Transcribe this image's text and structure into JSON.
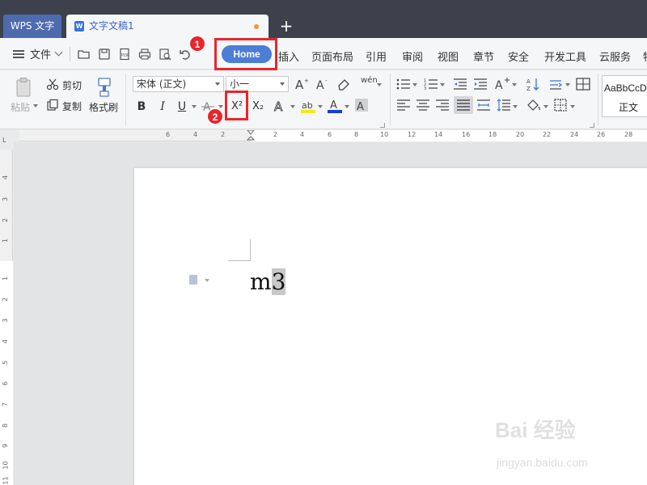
{
  "window": {
    "app_tab": "WPS 文字",
    "doc_tab": "文字文稿1",
    "doc_icon_letter": "W",
    "new_tab": "+"
  },
  "menu": {
    "file": "文件",
    "tabs": [
      "Home",
      "插入",
      "页面布局",
      "引用",
      "审阅",
      "视图",
      "章节",
      "安全",
      "开发工具",
      "云服务",
      "特"
    ]
  },
  "ribbon": {
    "paste": "粘贴",
    "cut": "剪切",
    "copy": "复制",
    "format_painter": "格式刷",
    "font_name": "宋体 (正文)",
    "font_size": "小一",
    "pinyin": "wén",
    "bold": "B",
    "italic": "I",
    "underline": "U",
    "superscript": "X²",
    "subscript": "X₂",
    "style_preview": "AaBbCcD",
    "style_name": "正文"
  },
  "ruler": {
    "top_numbers": [
      "6",
      "4",
      "2",
      "2",
      "4",
      "6",
      "8",
      "10",
      "12",
      "14",
      "16",
      "18",
      "20",
      "22",
      "24",
      "26",
      "28"
    ],
    "left_numbers": [
      "4",
      "3",
      "2",
      "1",
      "1",
      "2",
      "3",
      "4",
      "5",
      "6",
      "7",
      "8",
      "9",
      "10",
      "11"
    ],
    "corner": "L"
  },
  "document": {
    "text_base": "m",
    "text_selected": "3"
  },
  "annotations": {
    "badge1": "1",
    "badge2": "2"
  },
  "watermark": {
    "main": "Bai 经验",
    "sub": "jingyan.baidu.com"
  }
}
